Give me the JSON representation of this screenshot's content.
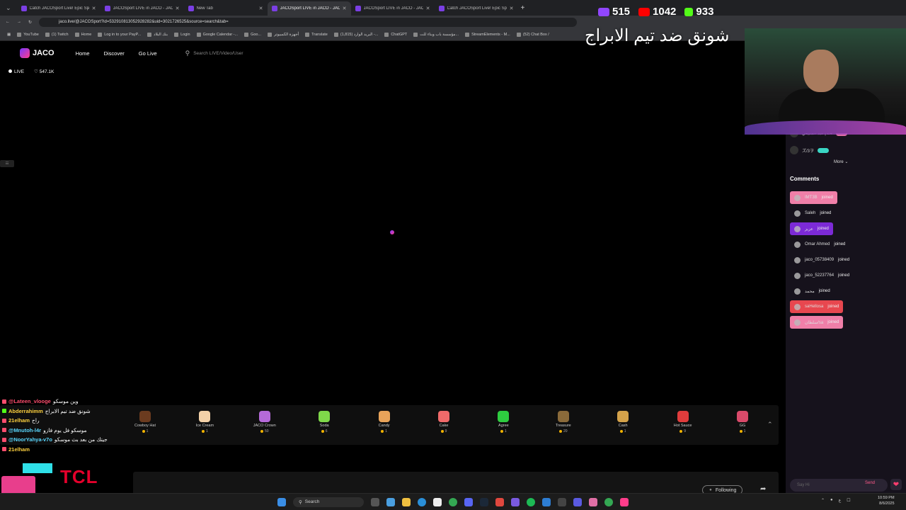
{
  "browser": {
    "tabs": [
      {
        "title": "Catch JACOSport Live! Epic Sp̶c",
        "active": false
      },
      {
        "title": "JACOSport LIVE in JACO - JACO",
        "active": false
      },
      {
        "title": "New Tab",
        "active": false
      },
      {
        "title": "JACOSport LIVE in JACO - JACO",
        "active": true
      },
      {
        "title": "JACOSport LIVE in JACO - JACO",
        "active": false
      },
      {
        "title": "Catch JACOSport Live! Epic Sp",
        "active": false
      }
    ],
    "new_tab": "+",
    "url": "jaco.live/@JACOSport?id=532910813052928282&uid=3021726525&source=search&tab=",
    "bookmarks": [
      "YouTube",
      "(1) Twitch",
      "Home",
      "Log in to your PayP...",
      "بنك البلاد",
      "Login",
      "Google Calendar -...",
      "Goo...",
      "أجهزة الكمبيوتر",
      "Translate",
      "(1,815) البريد الوارد -...",
      "ChatGPT",
      "مؤسسة باب وبناء للت...",
      "StreamElements - M...",
      "(52) Chat Box /"
    ]
  },
  "site": {
    "logo": "JACO",
    "nav": [
      "Home",
      "Discover",
      "Go Live"
    ],
    "search_placeholder": "Search LIVE/Video/User",
    "live_label": "LIVE",
    "likes": "547.1K"
  },
  "overlay": {
    "counters": [
      {
        "platform": "twitch",
        "value": "515",
        "color": "#9146ff"
      },
      {
        "platform": "youtube",
        "value": "1042",
        "color": "#ff0000"
      },
      {
        "platform": "kick",
        "value": "933",
        "color": "#53fc18"
      }
    ],
    "arabic_title": "شونق ضد تيم الابراج"
  },
  "right_panel": {
    "viewers": [
      {
        "name": "عبد السبيعي | E4",
        "tag": "",
        "tag_color": "#e06fa5"
      },
      {
        "name": "ズ/3ヲ",
        "tag": "",
        "tag_color": "#3ad6c4"
      }
    ],
    "more": "More",
    "comments_title": "Comments",
    "comments": [
      {
        "user": "IMT3B",
        "text": "joined",
        "bg": "#f07fa8"
      },
      {
        "user": "Saleh",
        "text": "joined",
        "bg": ""
      },
      {
        "user": "عزيز",
        "text": "joined",
        "bg": "#7c2ad6"
      },
      {
        "user": "Omar Ahmed",
        "text": "joined",
        "bg": ""
      },
      {
        "user": "jaco_05738409",
        "text": "joined",
        "bg": ""
      },
      {
        "user": "jaco_52237764",
        "text": "joined",
        "bg": ""
      },
      {
        "user": "محمد",
        "text": "joined",
        "bg": ""
      },
      {
        "user": "saHellosa",
        "text": "joined",
        "bg": "#e8474f"
      },
      {
        "user": "سلطان/sa",
        "text": "joined",
        "bg": "#f07fa8"
      }
    ],
    "say_placeholder": "Say Hi",
    "send": "Send"
  },
  "gifts": [
    {
      "name": "Cowboy Hat",
      "price": "1",
      "color": "#6b3b1f"
    },
    {
      "name": "Ice Cream",
      "price": "1",
      "color": "#f3d1a8"
    },
    {
      "name": "JACO Crown",
      "price": "50",
      "color": "#b56ad8"
    },
    {
      "name": "Soda",
      "price": "6",
      "color": "#7fd84a"
    },
    {
      "name": "Candy",
      "price": "1",
      "color": "#e8a35a"
    },
    {
      "name": "Cake",
      "price": "9",
      "color": "#f06a6a"
    },
    {
      "name": "Agree",
      "price": "1",
      "color": "#2ecc40"
    },
    {
      "name": "Treasure",
      "price": "20",
      "color": "#8a6a3a"
    },
    {
      "name": "Cash",
      "price": "1",
      "color": "#d4a24a"
    },
    {
      "name": "Hot Sauce",
      "price": "9",
      "color": "#e03c3c"
    },
    {
      "name": "GG",
      "price": "1",
      "color": "#d94a6a"
    }
  ],
  "following": "Following",
  "chat_overlay": [
    {
      "user": "@Lateen_vlooge",
      "text": "وين موسكو",
      "user_color": "#ff4d6d",
      "icon": "#ff4d6d"
    },
    {
      "user": "Abderrahimm",
      "text": "شونق ضد تيم الابراج",
      "user_color": "#ffd23f",
      "icon": "#53fc18"
    },
    {
      "user": "21elham",
      "text": "راح",
      "user_color": "#ffd23f",
      "icon": "#ff4d6d"
    },
    {
      "user": "@Mnutoh-l4r",
      "text": "موسكو فل يوم فازو",
      "user_color": "#5ad8ff",
      "icon": "#ff4d6d"
    },
    {
      "user": "@NoorYahya-v7o",
      "text": "جيتك من بعد بث موسكو",
      "user_color": "#5ad8ff",
      "icon": "#ff4d6d"
    },
    {
      "user": "21elham",
      "text": "",
      "user_color": "#ffd23f",
      "icon": "#ff4d6d"
    }
  ],
  "brand_overlay": "TCL",
  "taskbar": {
    "search": "Search",
    "time": "10:59 PM",
    "date": "8/6/2025"
  }
}
